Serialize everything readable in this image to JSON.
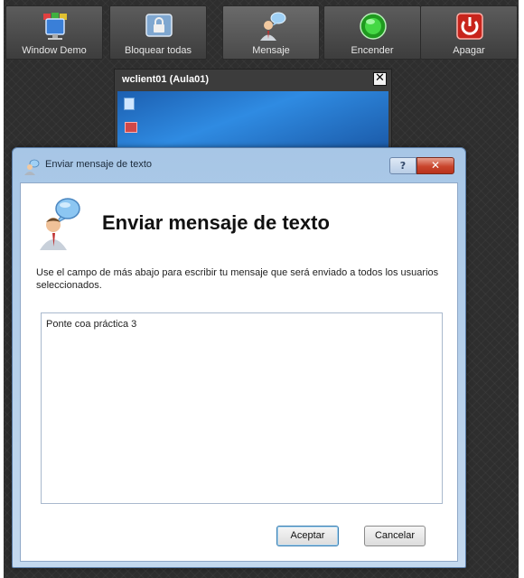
{
  "toolbar": {
    "buttons": [
      {
        "label": "Window Demo",
        "icon": "computer-group-icon"
      },
      {
        "label": "Bloquear todas",
        "icon": "lock-screen-icon"
      },
      {
        "label": "Mensaje",
        "icon": "message-user-icon"
      },
      {
        "label": "Encender",
        "icon": "power-on-green-icon"
      },
      {
        "label": "Apagar",
        "icon": "power-off-red-icon"
      }
    ]
  },
  "client_tile": {
    "title": "wclient01 (Aula01)",
    "close_label": "✕"
  },
  "dialog": {
    "window_title": "Enviar mensaje de texto",
    "help_label": "?",
    "close_label": "✕",
    "heading": "Enviar mensaje de texto",
    "description": "Use el campo de más abajo para escribir tu mensaje que será enviado a todos los usuarios seleccionados.",
    "message_value": "Ponte coa práctica 3",
    "ok_label": "Aceptar",
    "cancel_label": "Cancelar"
  },
  "colors": {
    "toolbar_bg": "#4a4a4a",
    "app_bg": "#2e2e2e",
    "dialog_frame": "#b3cce8",
    "power_on": "#2fbf2f",
    "power_off": "#c8241c"
  }
}
